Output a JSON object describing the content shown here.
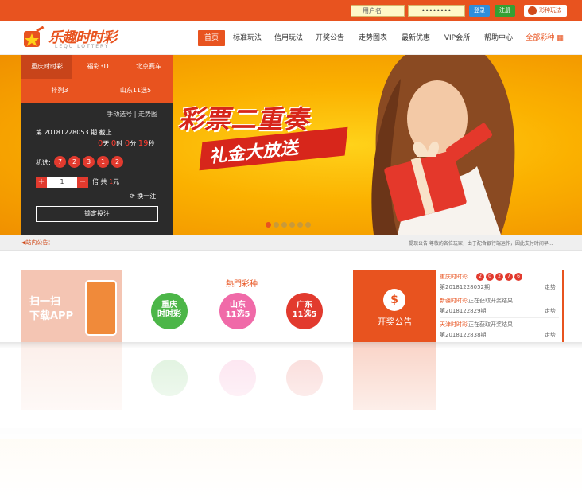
{
  "topbar": {
    "username_placeholder": "用户名",
    "password_placeholder": "••••••••",
    "login_label": "登录",
    "register_label": "注册",
    "rules_label": "彩种玩法"
  },
  "logo": {
    "name": "乐趣时时彩",
    "sub": "LEQU LOTTERY"
  },
  "nav": {
    "items": [
      "首页",
      "标准玩法",
      "信用玩法",
      "开奖公告",
      "走势图表",
      "最新优惠",
      "VIP会所",
      "帮助中心",
      "全部彩种"
    ]
  },
  "banner": {
    "slogan_top": "彩票二重奏",
    "slogan_bottom": "礼金大放送",
    "slide_count": 6,
    "active_slide": 0
  },
  "panel": {
    "tabs": [
      "重庆时时彩",
      "福彩3D",
      "北京赛车",
      "排列3",
      "山东11选5"
    ],
    "tools": "手动选号 | 走势图",
    "issue_text": "第 20181228053 期 截止",
    "countdown": {
      "days": "0",
      "d_label": "天",
      "hours": "0",
      "h_label": "时",
      "minutes": "0",
      "m_label": "分",
      "seconds": "19",
      "s_label": "秒"
    },
    "pick_label": "机选:",
    "balls": [
      "7",
      "2",
      "3",
      "1",
      "2"
    ],
    "multiplier": "1",
    "times_label": "倍 共",
    "amount": "1",
    "yuan_label": "元",
    "swap_label": "换一注",
    "confirm_label": "锁定投注"
  },
  "notice": {
    "label": "站内公告：",
    "message": "提现公告 尊敬的各位玩家，由于配合银行端运作，因此支付时间早..."
  },
  "app": {
    "line1": "扫一扫",
    "line2": "下载APP"
  },
  "hot": {
    "title": "熱門彩种",
    "items": [
      {
        "line1": "重庆",
        "line2": "时时彩",
        "color": "#4cb648"
      },
      {
        "line1": "山东",
        "line2": "11选5",
        "color": "#f06aa8"
      },
      {
        "line1": "广东",
        "line2": "11选5",
        "color": "#e23a2e"
      }
    ]
  },
  "open": {
    "icon": "$",
    "label": "开奖公告"
  },
  "results": [
    {
      "name": "重庆时时彩",
      "issue": "第20181228052期",
      "status": "",
      "balls": [
        "2",
        "0",
        "2",
        "7",
        "6"
      ],
      "trend": "走势"
    },
    {
      "name": "新疆时时彩",
      "issue": "第2018122829期",
      "status": "正在获取开奖结果",
      "balls": [],
      "trend": "走势"
    },
    {
      "name": "天津时时彩",
      "issue": "第2018122838期",
      "status": "正在获取开奖结果",
      "balls": [],
      "trend": "走势"
    }
  ]
}
